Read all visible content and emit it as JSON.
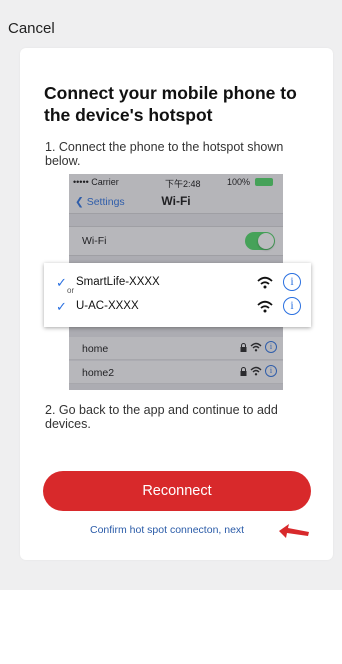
{
  "header": {
    "cancel_label": "Cancel"
  },
  "card": {
    "title": "Connect your mobile phone to the device's hotspot",
    "step1": "1. Connect the phone to the hotspot shown below.",
    "step2": "2. Go back to the app and continue to add devices.",
    "reconnect_label": "Reconnect",
    "next_link": "Confirm hot spot connecton, next"
  },
  "phone_illustration": {
    "carrier": "••••• Carrier",
    "time": "下午2:48",
    "battery": "100%",
    "back_label": "Settings",
    "nav_title": "Wi-Fi",
    "wifi_label": "Wi-Fi",
    "networks": [
      "home",
      "home2"
    ]
  },
  "popup": {
    "rows": [
      {
        "label": "SmartLife-XXXX"
      },
      {
        "label": "U-AC-XXXX"
      }
    ],
    "or_label": "or"
  },
  "colors": {
    "accent_red": "#d8292b",
    "link_blue": "#2a5ba8",
    "ios_blue": "#2a70e0",
    "toggle_green": "#4cd964"
  }
}
